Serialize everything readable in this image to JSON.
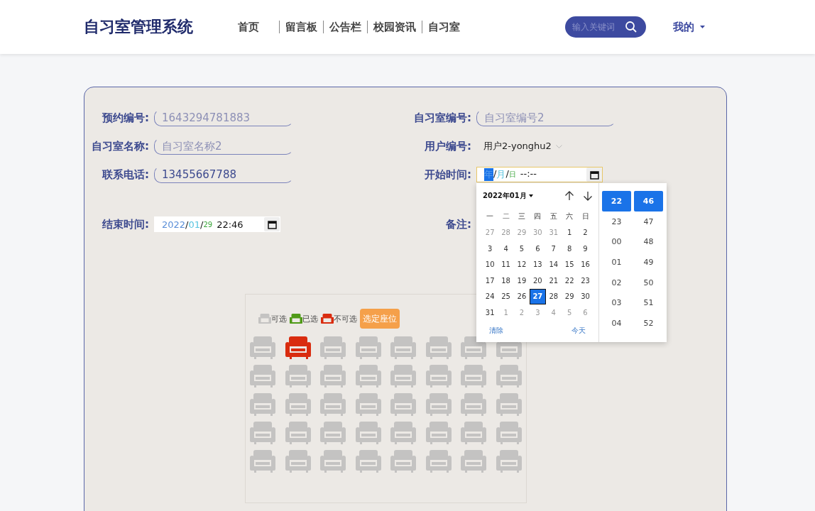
{
  "header": {
    "title": "自习室管理系统",
    "nav": [
      {
        "label": "首页"
      },
      {
        "label": "留言板"
      },
      {
        "label": "公告栏"
      },
      {
        "label": "校园资讯"
      },
      {
        "label": "自习室"
      }
    ],
    "search": {
      "placeholder": "输入关键词"
    },
    "user_menu": "我的"
  },
  "form": {
    "rows": [
      [
        {
          "label": "预约编号:",
          "kind": "text",
          "value": "1643294781883",
          "disabled": true
        },
        {
          "label": "自习室编号:",
          "kind": "text",
          "value": "自习室编号2",
          "disabled": true
        }
      ],
      [
        {
          "label": "自习室名称:",
          "kind": "text",
          "value": "自习室名称2",
          "disabled": true
        },
        {
          "label": "用户编号:",
          "kind": "select",
          "value": "用户2-yonghu2"
        }
      ],
      [
        {
          "label": "联系电话:",
          "kind": "text",
          "value": "13455667788",
          "disabled": false
        },
        {
          "label": "开始时间:",
          "kind": "datetime",
          "focused": true,
          "segments": [
            {
              "kind": "year",
              "text": "年",
              "selected": true
            },
            {
              "kind": "sep",
              "text": "/",
              "selected": false
            },
            {
              "kind": "month",
              "text": "月",
              "selected": false
            },
            {
              "kind": "sep",
              "text": "/",
              "selected": false
            },
            {
              "kind": "day",
              "text": "日",
              "selected": false
            },
            {
              "kind": "time",
              "text": "--:--",
              "selected": false
            }
          ]
        }
      ],
      [
        {
          "label": "结束时间:",
          "kind": "datetime",
          "focused": false,
          "segments": [
            {
              "kind": "year",
              "text": "2022",
              "selected": false
            },
            {
              "kind": "sep",
              "text": "/",
              "selected": false
            },
            {
              "kind": "month",
              "text": "01",
              "selected": false
            },
            {
              "kind": "sep",
              "text": "/",
              "selected": false
            },
            {
              "kind": "day",
              "text": "29",
              "selected": false
            },
            {
              "kind": "time",
              "text": "22:46",
              "selected": false
            }
          ]
        },
        {
          "label": "备注:",
          "kind": "none"
        }
      ]
    ]
  },
  "picker": {
    "month": "2022年01月",
    "weekdays": [
      "一",
      "二",
      "三",
      "四",
      "五",
      "六",
      "日"
    ],
    "days": [
      {
        "text": "27",
        "muted": true,
        "selected": false
      },
      {
        "text": "28",
        "muted": true,
        "selected": false
      },
      {
        "text": "29",
        "muted": true,
        "selected": false
      },
      {
        "text": "30",
        "muted": true,
        "selected": false
      },
      {
        "text": "31",
        "muted": true,
        "selected": false
      },
      {
        "text": "1",
        "muted": false,
        "selected": false
      },
      {
        "text": "2",
        "muted": false,
        "selected": false
      },
      {
        "text": "3",
        "muted": false,
        "selected": false
      },
      {
        "text": "4",
        "muted": false,
        "selected": false
      },
      {
        "text": "5",
        "muted": false,
        "selected": false
      },
      {
        "text": "6",
        "muted": false,
        "selected": false
      },
      {
        "text": "7",
        "muted": false,
        "selected": false
      },
      {
        "text": "8",
        "muted": false,
        "selected": false
      },
      {
        "text": "9",
        "muted": false,
        "selected": false
      },
      {
        "text": "10",
        "muted": false,
        "selected": false
      },
      {
        "text": "11",
        "muted": false,
        "selected": false
      },
      {
        "text": "12",
        "muted": false,
        "selected": false
      },
      {
        "text": "13",
        "muted": false,
        "selected": false
      },
      {
        "text": "14",
        "muted": false,
        "selected": false
      },
      {
        "text": "15",
        "muted": false,
        "selected": false
      },
      {
        "text": "16",
        "muted": false,
        "selected": false
      },
      {
        "text": "17",
        "muted": false,
        "selected": false
      },
      {
        "text": "18",
        "muted": false,
        "selected": false
      },
      {
        "text": "19",
        "muted": false,
        "selected": false
      },
      {
        "text": "20",
        "muted": false,
        "selected": false
      },
      {
        "text": "21",
        "muted": false,
        "selected": false
      },
      {
        "text": "22",
        "muted": false,
        "selected": false
      },
      {
        "text": "23",
        "muted": false,
        "selected": false
      },
      {
        "text": "24",
        "muted": false,
        "selected": false
      },
      {
        "text": "25",
        "muted": false,
        "selected": false
      },
      {
        "text": "26",
        "muted": false,
        "selected": false
      },
      {
        "text": "27",
        "muted": false,
        "selected": true
      },
      {
        "text": "28",
        "muted": false,
        "selected": false
      },
      {
        "text": "29",
        "muted": false,
        "selected": false
      },
      {
        "text": "30",
        "muted": false,
        "selected": false
      },
      {
        "text": "31",
        "muted": false,
        "selected": false
      },
      {
        "text": "1",
        "muted": true,
        "selected": false
      },
      {
        "text": "2",
        "muted": true,
        "selected": false
      },
      {
        "text": "3",
        "muted": true,
        "selected": false
      },
      {
        "text": "4",
        "muted": true,
        "selected": false
      },
      {
        "text": "5",
        "muted": true,
        "selected": false
      },
      {
        "text": "6",
        "muted": true,
        "selected": false
      }
    ],
    "clear": "清除",
    "today": "今天",
    "hours": [
      {
        "text": "22",
        "selected": true
      },
      {
        "text": "23",
        "selected": false
      },
      {
        "text": "00",
        "selected": false
      },
      {
        "text": "01",
        "selected": false
      },
      {
        "text": "02",
        "selected": false
      },
      {
        "text": "03",
        "selected": false
      },
      {
        "text": "04",
        "selected": false
      }
    ],
    "minutes": [
      {
        "text": "46",
        "selected": true
      },
      {
        "text": "47",
        "selected": false
      },
      {
        "text": "48",
        "selected": false
      },
      {
        "text": "49",
        "selected": false
      },
      {
        "text": "50",
        "selected": false
      },
      {
        "text": "51",
        "selected": false
      },
      {
        "text": "52",
        "selected": false
      }
    ]
  },
  "seating": {
    "legend": [
      {
        "label": "可选",
        "kind": "free"
      },
      {
        "label": "已选",
        "kind": "chosen"
      },
      {
        "label": "不可选",
        "kind": "taken"
      }
    ],
    "confirm": "选定座位",
    "rows": [
      {
        "seats": [
          {
            "kind": "free"
          },
          {
            "kind": "taken"
          },
          {
            "kind": "free"
          },
          {
            "kind": "free"
          },
          {
            "kind": "free"
          },
          {
            "kind": "free"
          },
          {
            "kind": "free"
          },
          {
            "kind": "free"
          }
        ]
      },
      {
        "seats": [
          {
            "kind": "free"
          },
          {
            "kind": "free"
          },
          {
            "kind": "free"
          },
          {
            "kind": "free"
          },
          {
            "kind": "free"
          },
          {
            "kind": "free"
          },
          {
            "kind": "free"
          },
          {
            "kind": "free"
          }
        ]
      },
      {
        "seats": [
          {
            "kind": "free"
          },
          {
            "kind": "free"
          },
          {
            "kind": "free"
          },
          {
            "kind": "free"
          },
          {
            "kind": "free"
          },
          {
            "kind": "free"
          },
          {
            "kind": "free"
          },
          {
            "kind": "free"
          }
        ]
      },
      {
        "seats": [
          {
            "kind": "free"
          },
          {
            "kind": "free"
          },
          {
            "kind": "free"
          },
          {
            "kind": "free"
          },
          {
            "kind": "free"
          },
          {
            "kind": "free"
          },
          {
            "kind": "free"
          },
          {
            "kind": "free"
          }
        ]
      },
      {
        "seats": [
          {
            "kind": "free"
          },
          {
            "kind": "free"
          },
          {
            "kind": "free"
          },
          {
            "kind": "free"
          },
          {
            "kind": "free"
          },
          {
            "kind": "free"
          },
          {
            "kind": "free"
          },
          {
            "kind": "free"
          }
        ]
      }
    ]
  }
}
